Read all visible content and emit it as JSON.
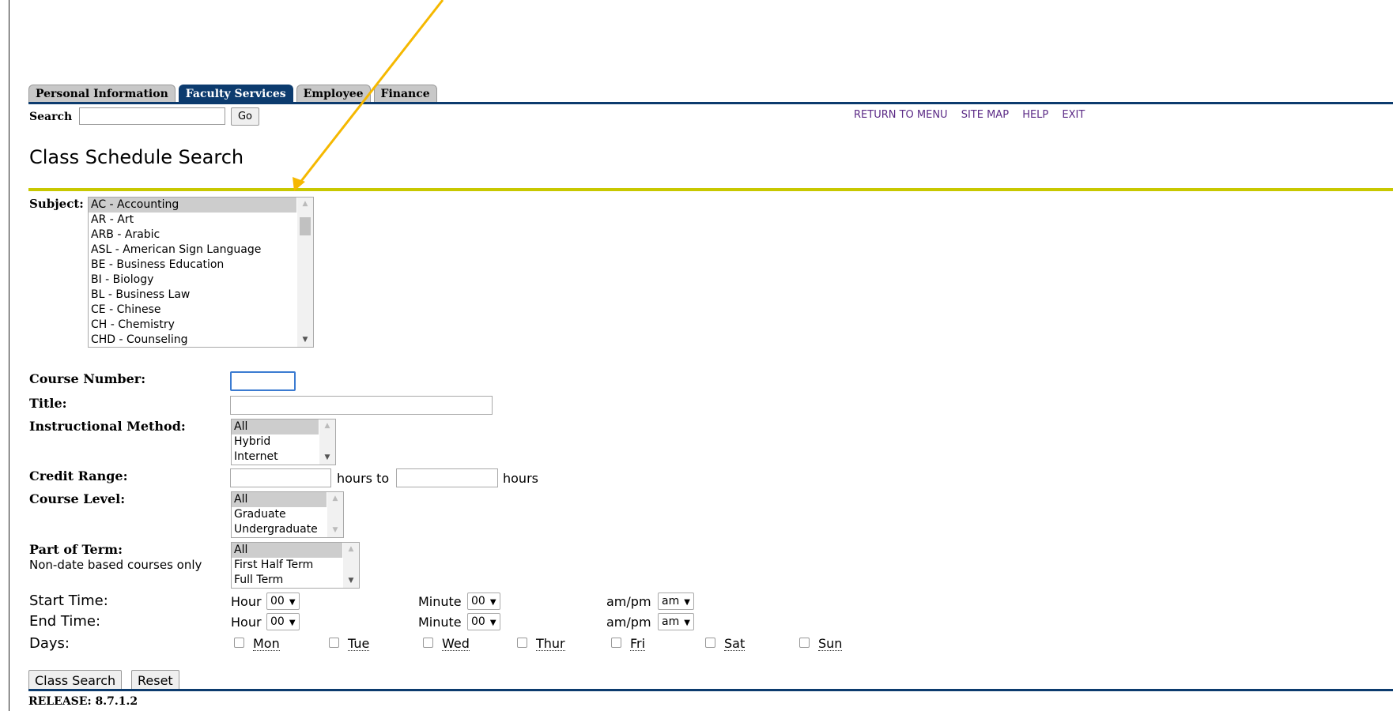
{
  "tabs": [
    "Personal Information",
    "Faculty Services",
    "Employee",
    "Finance"
  ],
  "search": {
    "label": "Search",
    "value": "",
    "go_label": "Go"
  },
  "top_links": [
    "RETURN TO MENU",
    "SITE MAP",
    "HELP",
    "EXIT"
  ],
  "page_title": "Class Schedule Search",
  "subject": {
    "label": "Subject:",
    "options": [
      "AC - Accounting",
      "AR - Art",
      "ARB - Arabic",
      "ASL - American Sign Language",
      "BE - Business Education",
      "BI - Biology",
      "BL - Business Law",
      "CE - Chinese",
      "CH - Chemistry",
      "CHD - Counseling"
    ],
    "selected": "AC - Accounting"
  },
  "course_number": {
    "label": "Course Number:",
    "value": ""
  },
  "title_field": {
    "label": "Title:",
    "value": ""
  },
  "instructional_method": {
    "label": "Instructional Method:",
    "options": [
      "All",
      "Hybrid",
      "Internet"
    ],
    "selected": "All"
  },
  "credit_range": {
    "label": "Credit Range:",
    "from": "",
    "to": "",
    "hours_to": "hours to",
    "hours": "hours"
  },
  "course_level": {
    "label": "Course Level:",
    "options": [
      "All",
      "Graduate",
      "Undergraduate"
    ],
    "selected": "All"
  },
  "part_of_term": {
    "label": "Part of Term:",
    "note": "Non-date based courses only",
    "options": [
      "All",
      "First Half Term",
      "Full Term"
    ],
    "selected": "All"
  },
  "start_time": {
    "label": "Start Time:",
    "hour_label": "Hour",
    "hour": "00",
    "minute_label": "Minute",
    "minute": "00",
    "ampm_label": "am/pm",
    "ampm": "am"
  },
  "end_time": {
    "label": "End Time:",
    "hour_label": "Hour",
    "hour": "00",
    "minute_label": "Minute",
    "minute": "00",
    "ampm_label": "am/pm",
    "ampm": "am"
  },
  "days": {
    "label": "Days:",
    "items": [
      "Mon",
      "Tue",
      "Wed",
      "Thur",
      "Fri",
      "Sat",
      "Sun"
    ]
  },
  "buttons": {
    "search": "Class Search",
    "reset": "Reset"
  },
  "release": "RELEASE: 8.7.1.2",
  "colors": {
    "tab_active": "#0c3b6e",
    "rule_yellow": "#c8c800",
    "link_purple": "#5b2a86",
    "annotation_arrow": "#f5b800"
  }
}
